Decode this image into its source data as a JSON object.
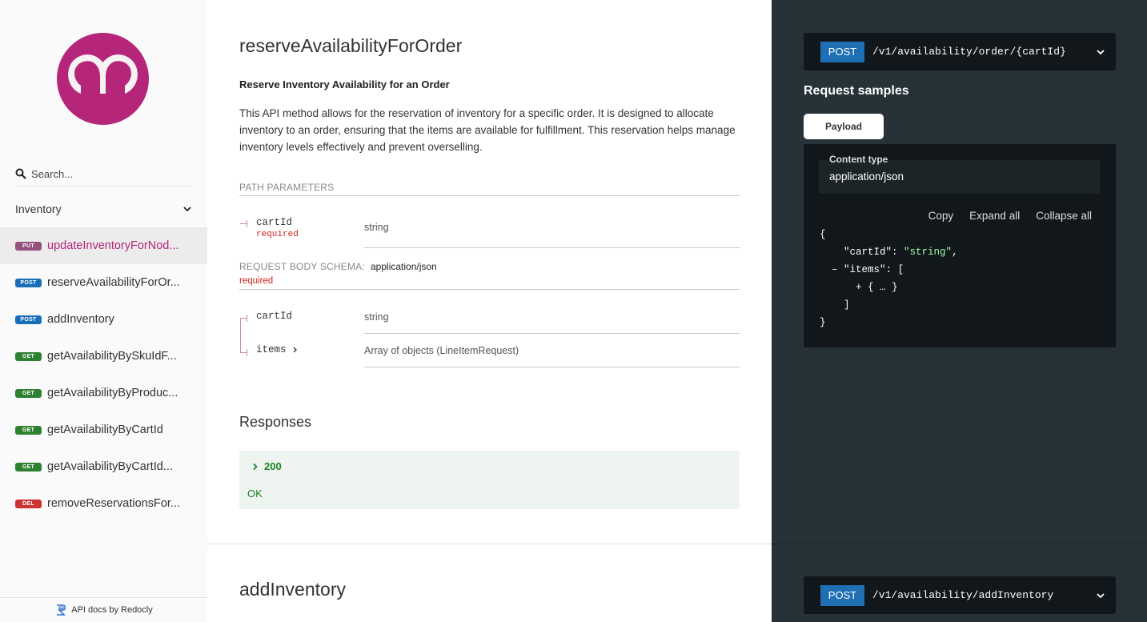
{
  "sidebar": {
    "search_placeholder": "Search...",
    "group_label": "Inventory",
    "items": [
      {
        "method": "PUT",
        "label": "updateInventoryForNod...",
        "active": true
      },
      {
        "method": "POST",
        "label": "reserveAvailabilityForOr..."
      },
      {
        "method": "POST",
        "label": "addInventory"
      },
      {
        "method": "GET",
        "label": "getAvailabilityBySkuIdF..."
      },
      {
        "method": "GET",
        "label": "getAvailabilityByProduc..."
      },
      {
        "method": "GET",
        "label": "getAvailabilityByCartId"
      },
      {
        "method": "GET",
        "label": "getAvailabilityByCartId..."
      },
      {
        "method": "DEL",
        "label": "removeReservationsFor..."
      }
    ],
    "footer": "API docs by Redocly"
  },
  "colors": {
    "brand": "#b5267b",
    "put": "#95507c",
    "post": "#186fb7",
    "get": "#2f8132",
    "del": "#cc3333"
  },
  "operation": {
    "title": "reserveAvailabilityForOrder",
    "summary": "Reserve Inventory Availability for an Order",
    "description": "This API method allows for the reservation of inventory for a specific order. It is designed to allocate inventory to an order, ensuring that the items are available for fulfillment. This reservation helps manage inventory levels effectively and prevent overselling.",
    "path_params_label": "PATH PARAMETERS",
    "path_params": [
      {
        "name": "cartId",
        "required": "required",
        "type": "string"
      }
    ],
    "body_label": "REQUEST BODY SCHEMA:",
    "body_content_type": "application/json",
    "body_required": "required",
    "body_params": [
      {
        "name": "cartId",
        "type": "string"
      },
      {
        "name": "items",
        "type": "Array of objects (LineItemRequest)"
      }
    ],
    "responses_label": "Responses",
    "responses": [
      {
        "code": "200",
        "description": "OK"
      }
    ]
  },
  "next_operation": {
    "title": "addInventory",
    "method": "POST",
    "path": "/v1/availability/addInventory"
  },
  "right_panel": {
    "method": "POST",
    "path": "/v1/availability/order/{cartId}",
    "request_samples_label": "Request samples",
    "payload_tab": "Payload",
    "content_type_label": "Content type",
    "content_type_value": "application/json",
    "actions": {
      "copy": "Copy",
      "expand": "Expand all",
      "collapse": "Collapse all"
    },
    "sample": {
      "open_brace": "{",
      "key_cartId": "\"cartId\"",
      "val_cartId": "\"string\"",
      "key_items": "\"items\"",
      "items_collapsed": "{ … }",
      "close_bracket": "]",
      "close_brace": "}"
    }
  }
}
